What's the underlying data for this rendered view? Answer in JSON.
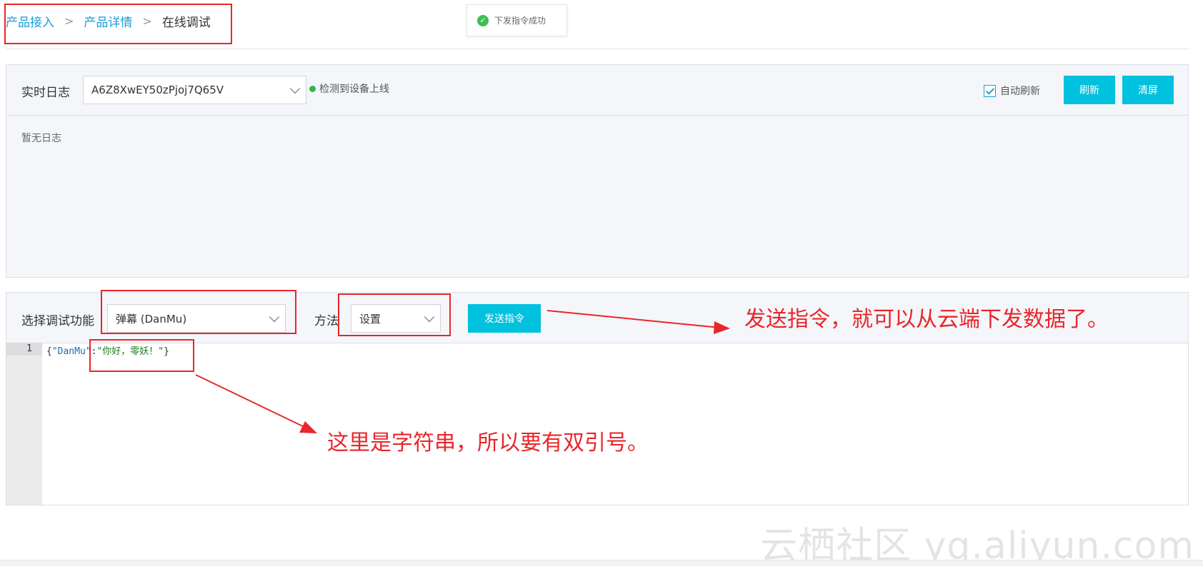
{
  "breadcrumb": {
    "items": [
      "产品接入",
      "产品详情"
    ],
    "current": "在线调试",
    "separator": ">"
  },
  "toast": {
    "message": "下发指令成功",
    "icon": "check-circle-icon"
  },
  "log_panel": {
    "title": "实时日志",
    "device_select": {
      "value": "A6Z8XwEY50zPjoj7Q65V"
    },
    "status": "检测到设备上线",
    "auto_refresh": {
      "label": "自动刷新",
      "checked": true
    },
    "refresh_label": "刷新",
    "clear_label": "清屏",
    "empty_text": "暂无日志"
  },
  "debug_panel": {
    "function_label": "选择调试功能",
    "function_select": {
      "value": "弹幕 (DanMu)"
    },
    "method_label": "方法",
    "method_select": {
      "value": "设置"
    },
    "send_label": "发送指令",
    "editor": {
      "line_number": "1",
      "tokens": {
        "open": "{",
        "key": "\"DanMu\"",
        "colon": ":",
        "value": "\"你好，零妖！\"",
        "close": "}"
      }
    }
  },
  "annotations": {
    "send_note": "发送指令，就可以从云端下发数据了。",
    "string_note": "这里是字符串，所以要有双引号。"
  },
  "watermark": "云栖社区 yq.aliyun.com",
  "colors": {
    "accent": "#00c1de",
    "link": "#1a9fd6",
    "annotation": "#e8262b",
    "success": "#30b84a"
  }
}
